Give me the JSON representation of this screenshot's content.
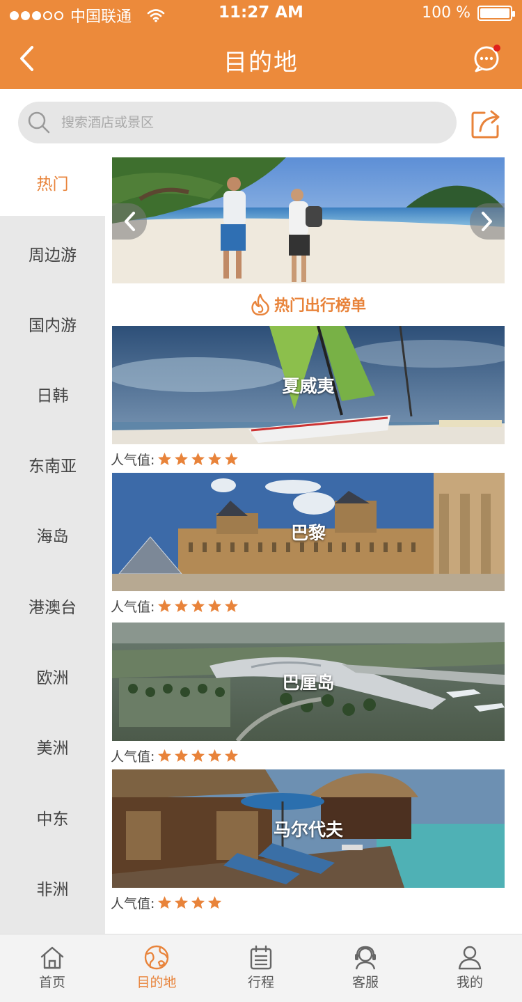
{
  "status_bar": {
    "carrier": "中国联通",
    "time": "11:27 AM",
    "battery": "100 %"
  },
  "header": {
    "title": "目的地",
    "has_unread": true
  },
  "search": {
    "placeholder": "搜索酒店或景区"
  },
  "sidebar": {
    "items": [
      {
        "label": "热门",
        "active": true
      },
      {
        "label": "周边游",
        "active": false
      },
      {
        "label": "国内游",
        "active": false
      },
      {
        "label": "日韩",
        "active": false
      },
      {
        "label": "东南亚",
        "active": false
      },
      {
        "label": "海岛",
        "active": false
      },
      {
        "label": "港澳台",
        "active": false
      },
      {
        "label": "欧洲",
        "active": false
      },
      {
        "label": "美洲",
        "active": false
      },
      {
        "label": "中东",
        "active": false
      },
      {
        "label": "非洲",
        "active": false
      }
    ]
  },
  "ranking": {
    "title": "热门出行榜单",
    "popularity_label": "人气值:",
    "destinations": [
      {
        "name": "夏威夷",
        "stars": 5
      },
      {
        "name": "巴黎",
        "stars": 5
      },
      {
        "name": "巴厘岛",
        "stars": 5
      },
      {
        "name": "马尔代夫",
        "stars": 4
      }
    ]
  },
  "tabbar": {
    "items": [
      {
        "label": "首页",
        "icon": "home-icon",
        "active": false
      },
      {
        "label": "目的地",
        "icon": "globe-icon",
        "active": true
      },
      {
        "label": "行程",
        "icon": "calendar-icon",
        "active": false
      },
      {
        "label": "客服",
        "icon": "headset-icon",
        "active": false
      },
      {
        "label": "我的",
        "icon": "user-icon",
        "active": false
      }
    ]
  },
  "colors": {
    "accent": "#ec8a3b",
    "star": "#e8833a",
    "sidebar_bg": "#e8e8e8"
  }
}
